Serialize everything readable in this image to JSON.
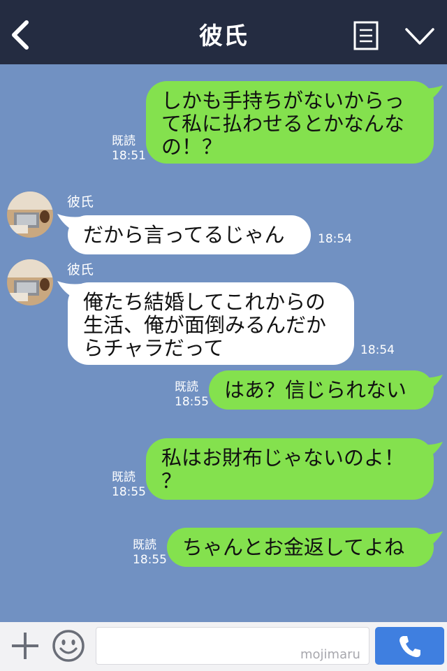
{
  "header": {
    "title": "彼氏"
  },
  "messages": [
    {
      "side": "me",
      "text": "しかも手持ちがないからっ\nて私に払わせるとかなんな\nの！？",
      "read": "既読",
      "time": "18:51"
    },
    {
      "side": "them",
      "sender": "彼氏",
      "text": "だから言ってるじゃん",
      "time": "18:54"
    },
    {
      "side": "them",
      "sender": "彼氏",
      "text": "俺たち結婚してこれからの\n生活、俺が面倒みるんだか\nらチャラだって",
      "time": "18:54"
    },
    {
      "side": "me",
      "text": "はあ？信じられない",
      "read": "既読",
      "time": "18:55"
    },
    {
      "side": "me",
      "text": "私はお財布じゃないのよ！\n？",
      "read": "既読",
      "time": "18:55"
    },
    {
      "side": "me",
      "text": "ちゃんとお金返してよね",
      "read": "既読",
      "time": "18:55"
    }
  ],
  "input": {
    "watermark": "mojimaru"
  },
  "colors": {
    "header": "#242c41",
    "background": "#7191c2",
    "my_bubble": "#84e14e",
    "their_bubble": "#ffffff",
    "call_button": "#3f7fe0"
  },
  "icons": {
    "back": "chevron-left-icon",
    "menu": "menu-icon",
    "more": "chevron-down-icon",
    "add": "plus-icon",
    "sticker": "smile-icon",
    "call": "phone-icon"
  }
}
